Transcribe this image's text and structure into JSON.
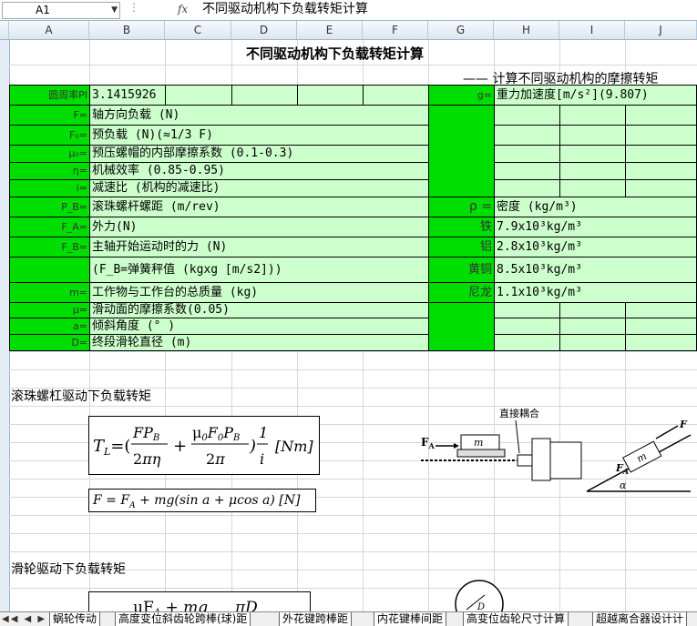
{
  "formula_bar": {
    "name_box": "A1",
    "fx_label": "fx",
    "content": "不同驱动机构下负载转矩计算"
  },
  "columns": [
    "A",
    "B",
    "C",
    "D",
    "E",
    "F",
    "G",
    "H",
    "I",
    "J"
  ],
  "sheet": {
    "title": "不同驱动机构下负载转矩计算",
    "subtitle": "—— 计算不同驱动机构的摩擦转矩",
    "params": [
      {
        "symbol": "圆周率PI",
        "text": "3.1415926"
      },
      {
        "symbol": "F=",
        "text": "轴方向负载 (N)"
      },
      {
        "symbol": "F₀=",
        "text": "预负载 (N)(≈1/3 F)"
      },
      {
        "symbol": "μ₀=",
        "text": "预压螺帽的内部摩擦系数 (0.1-0.3)"
      },
      {
        "symbol": "η=",
        "text": "机械效率 (0.85-0.95)"
      },
      {
        "symbol": "i=",
        "text": "减速比 (机构的减速比)"
      },
      {
        "symbol": "P_B=",
        "text": "滚珠螺杆螺距 (m/rev)"
      },
      {
        "symbol": "F_A=",
        "text": "外力(N)"
      },
      {
        "symbol": "F_B=",
        "text": "主轴开始运动时的力 (N)"
      },
      {
        "symbol": "",
        "text": "(F_B=弹簧秤值 (kgxg [m/s2]))"
      },
      {
        "symbol": "m=",
        "text": "工作物与工作台的总质量 (kg)"
      },
      {
        "symbol": "μ=",
        "text": "滑动面的摩擦系数(0.05)"
      },
      {
        "symbol": "a=",
        "text": "倾斜角度 (° )"
      },
      {
        "symbol": "D=",
        "text": "终段滑轮直径 (m)"
      }
    ],
    "right": {
      "g_label": "g=",
      "g_text": "重力加速度[m/s²](9.807)",
      "rho_label": "ρ =",
      "rho_text": "密度 (kg/m³)",
      "materials": [
        {
          "name": "铁",
          "value": "7.9x10³kg/m³"
        },
        {
          "name": "铝",
          "value": "2.8x10³kg/m³"
        },
        {
          "name": "黄铜",
          "value": "8.5x10³kg/m³"
        },
        {
          "name": "尼龙",
          "value": "1.1x10³kg/m³"
        }
      ]
    },
    "section1": "滚珠螺杠驱动下负载转矩",
    "formula1_lhs": "T",
    "formula1_lhs_sub": "L",
    "formula1_unit": "[Nm]",
    "formula2": "F = F",
    "formula2_sub": "A",
    "formula2_rest": " + mg(sin a + μcos a)  [N]",
    "section2": "滑轮驱动下负载转矩",
    "formula3_num": "μF",
    "formula3_num_sub": "A",
    "formula3_num_rest": " + mg",
    "formula3_num2": "πD",
    "illustration_label": "直接耦合",
    "illustration_fa": "F",
    "illustration_fa_sub": "A",
    "illustration_m": "m",
    "illustration_f": "F",
    "illustration_alpha": "α",
    "illustration_d": "D"
  },
  "tabs": [
    "蜗轮传动",
    "高度变位斜齿轮跨棒(球)距",
    "外花键跨棒距",
    "内花键棒间距",
    "高变位齿轮尺寸计算",
    "超越离合器设计计"
  ],
  "tab_nav": "◀◀ ◀ ▶ ▶▶"
}
